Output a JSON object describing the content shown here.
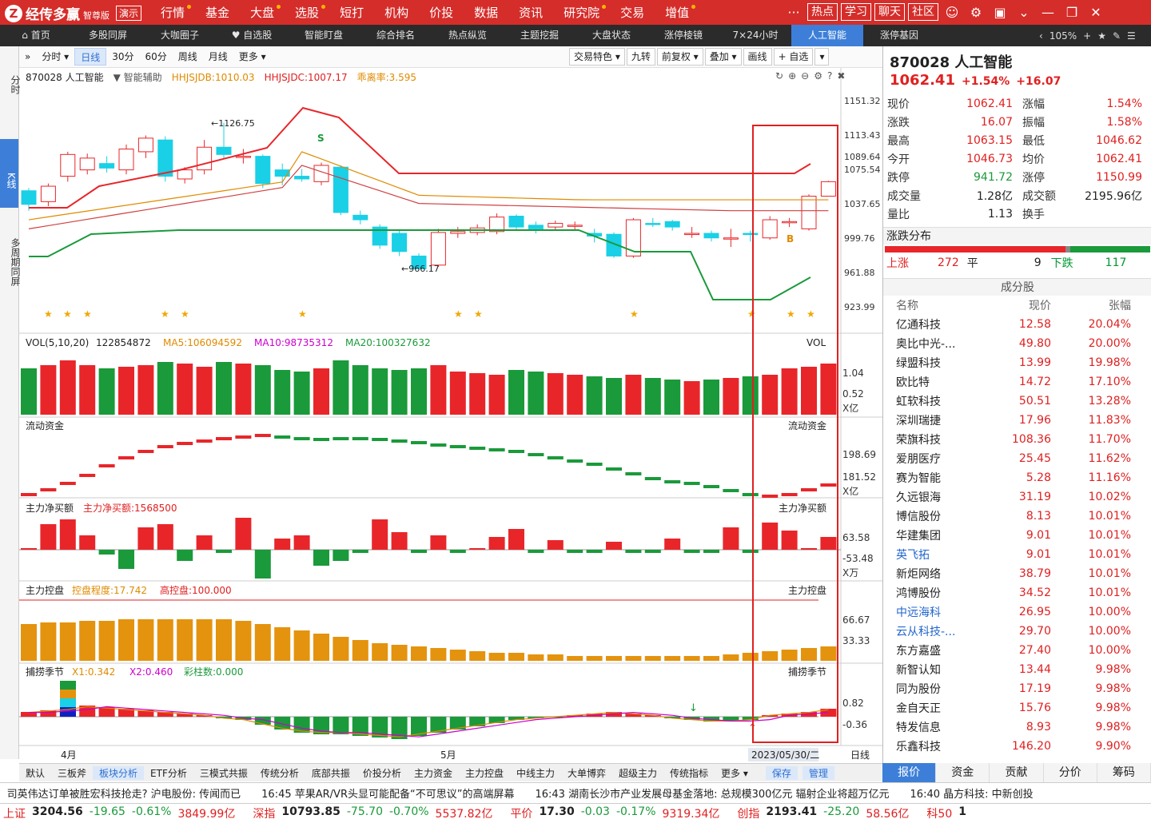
{
  "app": {
    "name": "经传多赢",
    "edition": "智尊版",
    "demo": "演示"
  },
  "nav": [
    {
      "label": "行情",
      "dot": true
    },
    {
      "label": "基金",
      "dot": false
    },
    {
      "label": "大盘",
      "dot": true
    },
    {
      "label": "选股",
      "dot": true
    },
    {
      "label": "短打",
      "dot": false
    },
    {
      "label": "机构",
      "dot": false
    },
    {
      "label": "价投",
      "dot": false
    },
    {
      "label": "数据",
      "dot": false
    },
    {
      "label": "资讯",
      "dot": false
    },
    {
      "label": "研究院",
      "dot": true
    },
    {
      "label": "交易",
      "dot": false
    },
    {
      "label": "增值",
      "dot": true
    }
  ],
  "topright": {
    "hot": "热点",
    "learn": "学习",
    "chat": "聊天",
    "community": "社区"
  },
  "subtabs": [
    "首页",
    "多股同屏",
    "大咖圈子",
    "自选股",
    "智能盯盘",
    "综合排名",
    "热点纵览",
    "主题挖掘",
    "大盘状态",
    "涨停棱镜",
    "7×24小时",
    "人工智能",
    "涨停基因"
  ],
  "subtabs_active": 11,
  "zoom": "105%",
  "leftcol": {
    "fenshi": "分时",
    "kline": "K线",
    "multi": "多周期同屏"
  },
  "toolbar": {
    "items": [
      "分时",
      "日线",
      "30分",
      "60分",
      "周线",
      "月线",
      "更多"
    ],
    "selected": 1,
    "right": [
      "交易特色",
      "九转",
      "前复权",
      "叠加",
      "画线",
      "自选"
    ]
  },
  "info": {
    "code": "870028 人工智能",
    "assist": "智能辅助",
    "hjdb": "HHJSJDB:1010.03",
    "hjdc": "HHJSJDC:1007.17",
    "qlv": "乖离率:3.595"
  },
  "price_axis": [
    "1151.32",
    "1113.43",
    "1089.64",
    "1075.54",
    "1037.65",
    "999.76",
    "961.88",
    "923.99"
  ],
  "hi_label": "1126.75",
  "lo_label": "966.17",
  "vol": {
    "title": "VOL(5,10,20)",
    "val": "122854872",
    "ma5": "MA5:106094592",
    "ma10": "MA10:98735312",
    "ma20": "MA20:100327632",
    "tag": "VOL",
    "ax1": "1.04",
    "ax2": "0.52",
    "unit": "X亿"
  },
  "flow": {
    "title": "流动资金",
    "ax1": "198.69",
    "ax2": "181.52",
    "unit": "X亿"
  },
  "net": {
    "title": "主力净买额",
    "val": "主力净买额:1568500",
    "ax1": "63.58",
    "ax2": "-53.48",
    "unit": "X万"
  },
  "ctrl": {
    "title": "主力控盘",
    "deg": "控盘程度:17.742",
    "high": "高控盘:100.000",
    "ax1": "66.67",
    "ax2": "33.33"
  },
  "season": {
    "title": "捕捞季节",
    "x1": "X1:0.342",
    "x2": "X2:0.460",
    "cz": "彩柱数:0.000",
    "ax1": "0.82",
    "ax2": "-0.36"
  },
  "dates": {
    "apr": "4月",
    "may": "5月",
    "cur": "2023/05/30/二",
    "line": "日线"
  },
  "bottomtabs": [
    "默认",
    "三板斧",
    "板块分析",
    "ETF分析",
    "三模式共振",
    "传统分析",
    "底部共振",
    "价投分析",
    "主力资金",
    "主力控盘",
    "中线主力",
    "大单博弈",
    "超级主力",
    "传统指标",
    "更多"
  ],
  "bottomtabs_sel": 2,
  "bottomright": {
    "save": "保存",
    "manage": "管理"
  },
  "rp": {
    "title": "870028 人工智能",
    "price": "1062.41",
    "pct": "+1.54%",
    "chg": "+16.07",
    "quote": [
      [
        "现价",
        "1062.41",
        "涨幅",
        "1.54%"
      ],
      [
        "涨跌",
        "16.07",
        "振幅",
        "1.58%"
      ],
      [
        "最高",
        "1063.15",
        "最低",
        "1046.62"
      ],
      [
        "今开",
        "1046.73",
        "均价",
        "1062.41"
      ],
      [
        "跌停",
        "941.72",
        "涨停",
        "1150.99"
      ],
      [
        "成交量",
        "1.28亿",
        "成交额",
        "2195.96亿"
      ],
      [
        "量比",
        "1.13",
        "换手",
        ""
      ]
    ],
    "dist_title": "涨跌分布",
    "up_label": "上涨",
    "up": "272",
    "flat_label": "平",
    "flat": "9",
    "down_label": "下跌",
    "down": "117",
    "cons_title": "成分股",
    "cols": [
      "名称",
      "现价",
      "张幅"
    ],
    "cons": [
      [
        "亿通科技",
        "12.58",
        "20.04%"
      ],
      [
        "奥比中光-...",
        "49.80",
        "20.00%"
      ],
      [
        "绿盟科技",
        "13.99",
        "19.98%"
      ],
      [
        "欧比特",
        "14.72",
        "17.10%"
      ],
      [
        "虹软科技",
        "50.51",
        "13.28%"
      ],
      [
        "深圳瑞捷",
        "17.96",
        "11.83%"
      ],
      [
        "荣旗科技",
        "108.36",
        "11.70%"
      ],
      [
        "爱朋医疗",
        "25.45",
        "11.62%"
      ],
      [
        "赛为智能",
        "5.28",
        "11.16%"
      ],
      [
        "久远银海",
        "31.19",
        "10.02%"
      ],
      [
        "博信股份",
        "8.13",
        "10.01%"
      ],
      [
        "华建集团",
        "9.01",
        "10.01%"
      ],
      [
        "英飞拓",
        "9.01",
        "10.01%"
      ],
      [
        "新炬网络",
        "38.79",
        "10.01%"
      ],
      [
        "鸿博股份",
        "34.52",
        "10.01%"
      ],
      [
        "中远海科",
        "26.95",
        "10.00%"
      ],
      [
        "云从科技-...",
        "29.70",
        "10.00%"
      ],
      [
        "东方嘉盛",
        "27.40",
        "10.00%"
      ],
      [
        "新智认知",
        "13.44",
        "9.98%"
      ],
      [
        "同为股份",
        "17.19",
        "9.98%"
      ],
      [
        "金自天正",
        "15.76",
        "9.98%"
      ],
      [
        "特发信息",
        "8.93",
        "9.98%"
      ],
      [
        "乐鑫科技",
        "146.20",
        "9.90%"
      ]
    ],
    "blue_rows": [
      12,
      15,
      16
    ],
    "tabs": [
      "报价",
      "资金",
      "贡献",
      "分价",
      "筹码"
    ]
  },
  "news": [
    " 司英伟达订单被胜宏科技抢走? 沪电股份: 传闻而已",
    "16:45 苹果AR/VR头显可能配备“不可思议”的高端屏幕",
    "16:43 湖南长沙市产业发展母基金落地: 总规模300亿元 辐射企业将超万亿元",
    "16:40 晶方科技: 中新创投"
  ],
  "indexbar": [
    [
      "上证",
      "3204.56",
      "-19.65",
      "-0.61%",
      "3849.99亿"
    ],
    [
      "深指",
      "10793.85",
      "-75.70",
      "-0.70%",
      "5537.82亿"
    ],
    [
      "平价",
      "17.30",
      "-0.03",
      "-0.17%",
      "9319.34亿"
    ],
    [
      "创指",
      "2193.41",
      "-25.20",
      "",
      " 58.56亿"
    ],
    [
      "科50",
      "1",
      "",
      " ",
      ""
    ]
  ],
  "colors": {
    "up": "#e8262a",
    "down": "#1a9a3a",
    "accent": "#3d7fd8",
    "brand": "#d52d2a",
    "highlight": "#e02020"
  }
}
